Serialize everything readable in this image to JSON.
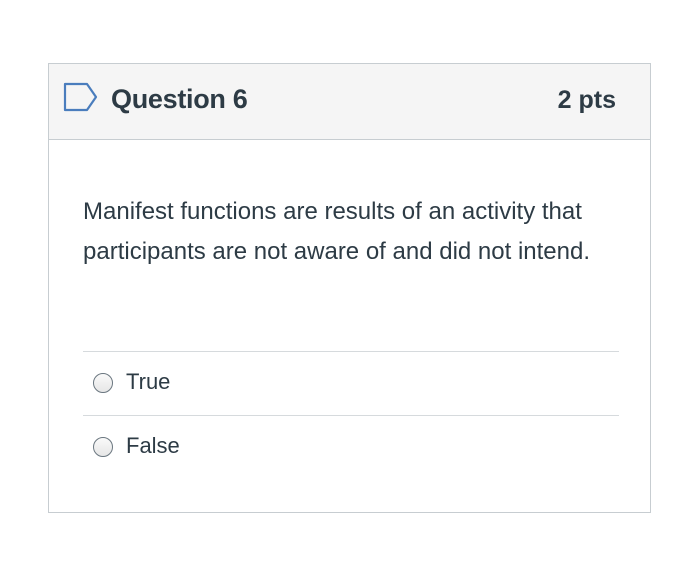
{
  "question": {
    "title": "Question 6",
    "points": "2 pts",
    "flag_icon": "flag-outline-icon",
    "text": "Manifest functions are results of an activity that participants are not aware of and did not intend.",
    "answers": [
      {
        "label": "True",
        "selected": false
      },
      {
        "label": "False",
        "selected": false
      }
    ]
  },
  "colors": {
    "text": "#2d3b45",
    "header_bg": "#f5f5f5",
    "border": "#c7cdd1",
    "flag_stroke": "#4a7dbd"
  }
}
